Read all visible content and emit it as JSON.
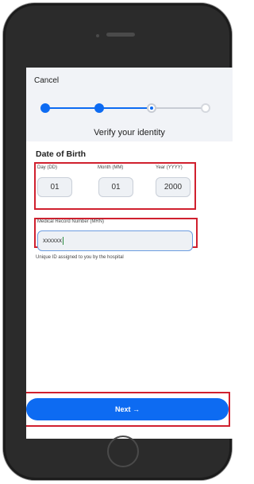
{
  "header": {
    "cancel_label": "Cancel",
    "title": "Verify your identity"
  },
  "stepper": {
    "current_step": 3,
    "total_steps": 4,
    "active_color": "#0d6bf2",
    "inactive_color": "#c8ccd4"
  },
  "dob": {
    "section_title": "Date of Birth",
    "fields": [
      {
        "label": "Day (DD)",
        "value": "01"
      },
      {
        "label": "Month (MM)",
        "value": "01"
      },
      {
        "label": "Year (YYYY)",
        "value": "2000"
      }
    ]
  },
  "mrn": {
    "label": "Medical Record Number (MRN)",
    "value": "xxxxxx",
    "help": "Unique ID assigned to you by the hospital"
  },
  "footer": {
    "next_label": "Next →"
  },
  "colors": {
    "highlight_red": "#d0202e",
    "button_blue": "#0d6bf2"
  }
}
